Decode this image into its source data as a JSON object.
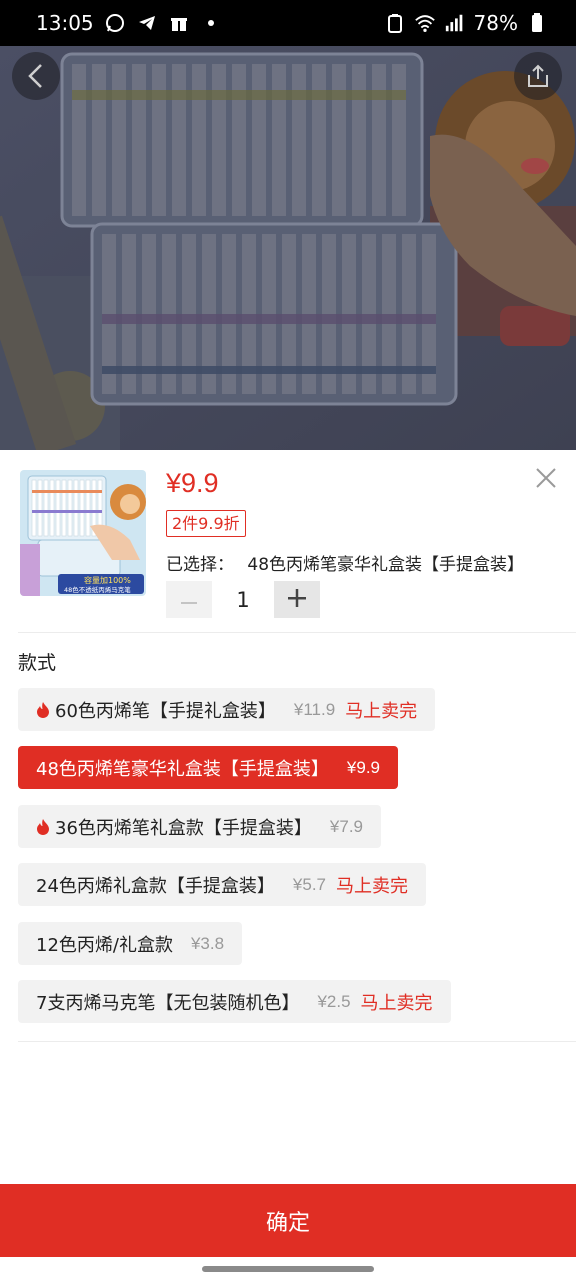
{
  "status_bar": {
    "time": "13:05",
    "battery": "78%",
    "icons": [
      "whatsapp-icon",
      "telegram-icon",
      "gift-icon",
      "dot-icon",
      "recycle-icon",
      "wifi-icon",
      "signal-icon",
      "battery-icon"
    ]
  },
  "hero": {
    "buttons": [
      "back-icon",
      "share-icon"
    ]
  },
  "product": {
    "price": "¥9.9",
    "promo": "2件9.9折",
    "selected_label": "已选择：",
    "selected_value": "48色丙烯笔豪华礼盒装【手提盒装】",
    "quantity": "1"
  },
  "styles": {
    "title": "款式",
    "options": [
      {
        "label": "60色丙烯笔【手提礼盒装】",
        "price": "¥11.9",
        "tag": "马上卖完",
        "hot": true,
        "selected": false
      },
      {
        "label": "48色丙烯笔豪华礼盒装【手提盒装】",
        "price": "¥9.9",
        "tag": "",
        "hot": false,
        "selected": true
      },
      {
        "label": "36色丙烯笔礼盒款【手提盒装】",
        "price": "¥7.9",
        "tag": "",
        "hot": true,
        "selected": false
      },
      {
        "label": "24色丙烯礼盒款【手提盒装】",
        "price": "¥5.7",
        "tag": "马上卖完",
        "hot": false,
        "selected": false
      },
      {
        "label": "12色丙烯/礼盒款",
        "price": "¥3.8",
        "tag": "",
        "hot": false,
        "selected": false
      },
      {
        "label": "7支丙烯马克笔【无包装随机色】",
        "price": "¥2.5",
        "tag": "马上卖完",
        "hot": false,
        "selected": false
      }
    ]
  },
  "thumbnail": {
    "caption_top": "容量加100%",
    "caption_bottom": "48色不透纸丙烯马克笔"
  },
  "confirm_label": "确定",
  "colors": {
    "accent": "#e02e24",
    "chip_bg": "#f2f2f2",
    "muted": "#999999"
  }
}
